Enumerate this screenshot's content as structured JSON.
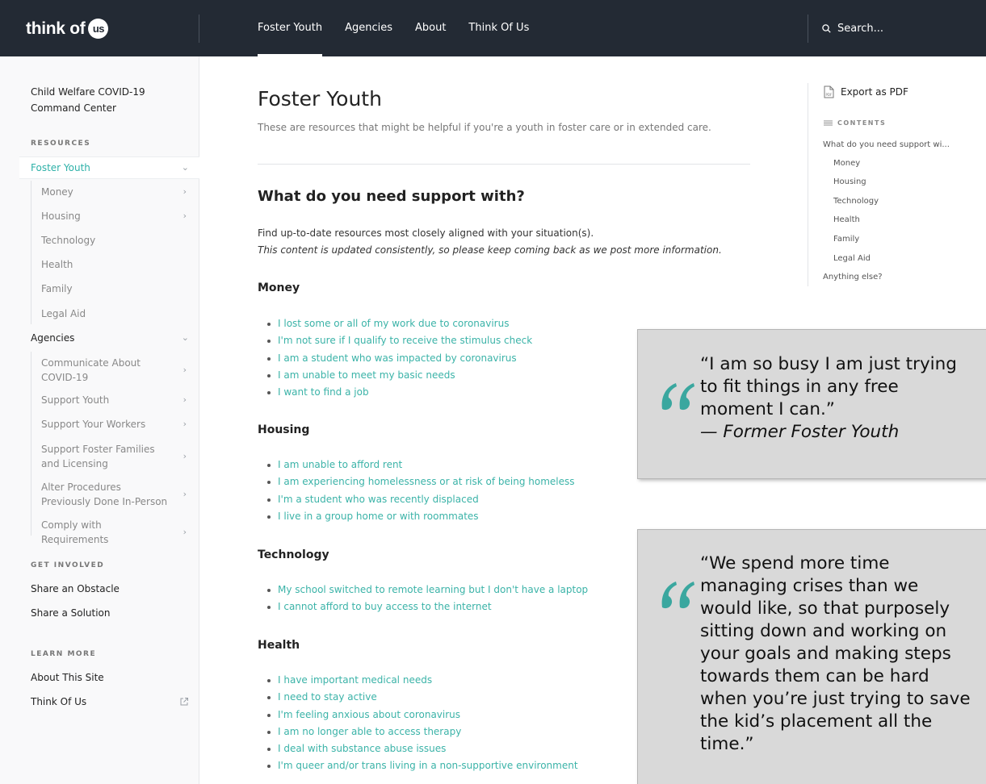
{
  "topbar": {
    "logo_text": "think of",
    "logo_badge": "us",
    "nav": [
      "Foster Youth",
      "Agencies",
      "About",
      "Think Of Us"
    ],
    "search_placeholder": "Search..."
  },
  "sidebar": {
    "title": "Child Welfare COVID-19 Command Center",
    "resources_heading": "RESOURCES",
    "foster_youth": "Foster Youth",
    "foster_youth_subs": [
      "Money",
      "Housing",
      "Technology",
      "Health",
      "Family",
      "Legal Aid"
    ],
    "agencies": "Agencies",
    "agencies_subs": [
      "Communicate About COVID-19",
      "Support Youth",
      "Support Your Workers",
      "Support Foster Families and Licensing",
      "Alter Procedures Previously Done In-Person",
      "Comply with Requirements"
    ],
    "get_involved_heading": "GET INVOLVED",
    "get_involved": [
      "Share an Obstacle",
      "Share a Solution"
    ],
    "learn_more_heading": "LEARN MORE",
    "learn_more": [
      "About This Site",
      "Think Of Us"
    ]
  },
  "main": {
    "title": "Foster Youth",
    "subtitle": "These are resources that might be helpful if you're a youth in foster care or in extended care.",
    "section_title": "What do you need support with?",
    "intro": "Find up-to-date resources most closely aligned with your situation(s).",
    "intro_italic": "This content is updated consistently, so please keep coming back as we post more information.",
    "groups": [
      {
        "heading": "Money",
        "links": [
          "I lost some or all of my work due to coronavirus",
          "I'm not sure if I qualify to receive the stimulus check",
          "I am a student who was impacted by coronavirus",
          "I am unable to meet my basic needs",
          "I want to find a job"
        ]
      },
      {
        "heading": "Housing",
        "links": [
          "I am unable to afford rent",
          "I am experiencing homelessness or at risk of being homeless",
          "I'm a student who was recently displaced",
          "I live in a group home or with roommates"
        ]
      },
      {
        "heading": "Technology",
        "links": [
          "My school switched to remote learning but I don't have a laptop",
          "I cannot afford to buy access to the internet"
        ]
      },
      {
        "heading": "Health",
        "links": [
          "I have important medical needs",
          "I need to stay active",
          "I'm feeling anxious about coronavirus",
          "I am no longer able to access therapy",
          "I deal with substance abuse issues",
          "I'm queer and/or trans living in a non-supportive environment"
        ]
      }
    ]
  },
  "toc": {
    "export": "Export as PDF",
    "contents_heading": "CONTENTS",
    "top": "What do you need support wi...",
    "subs": [
      "Money",
      "Housing",
      "Technology",
      "Health",
      "Family",
      "Legal Aid"
    ],
    "last": "Anything else?"
  },
  "quotes": [
    {
      "lines": [
        "“I am so busy I am just trying",
        "to fit things in any free",
        "moment I can.”"
      ],
      "attribution": "— Former Foster Youth"
    },
    {
      "lines": [
        "“We spend more time",
        "managing crises than we",
        "would like, so that purposely",
        "sitting down and working on",
        "your goals and making steps",
        "towards them can be hard",
        "when you’re just trying to save",
        "the kid’s placement all the",
        "time.”"
      ]
    }
  ],
  "colors": {
    "topbar": "#232a34",
    "accent": "#2eb1a8",
    "quote_mark": "#3aa79f"
  }
}
